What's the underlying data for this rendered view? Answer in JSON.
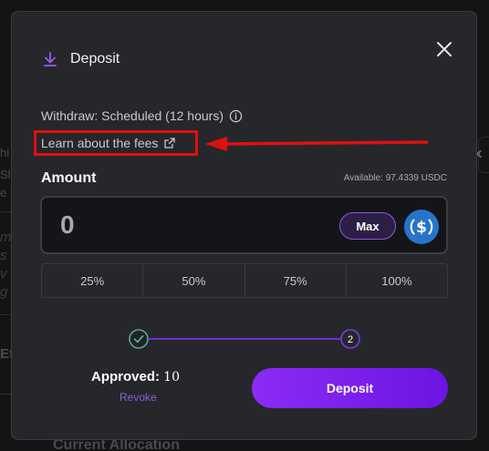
{
  "modal": {
    "title": "Deposit",
    "withdraw_text": "Withdraw: Scheduled (12 hours)",
    "learn_link": "Learn about the fees",
    "amount_label": "Amount",
    "available": "Available: 97.4339 USDC",
    "amount_value": "0",
    "max_label": "Max",
    "token_icon": "usdc-coin-icon",
    "percent_options": [
      "25%",
      "50%",
      "75%",
      "100%"
    ],
    "steps": {
      "step1": "check",
      "step2": "2"
    },
    "approved_label": "Approved:",
    "approved_value": "10",
    "revoke_label": "Revoke",
    "deposit_label": "Deposit"
  },
  "background": {
    "fragment_top": "hi",
    "fragment_s": "Sl",
    "fragment_e": "e",
    "fragment_m": "m",
    "fragment_s2": "s",
    "fragment_v": "v",
    "fragment_g": "g",
    "fragment_eth": "Eth",
    "right_fragment": "x",
    "footer_text": "Current Allocation"
  },
  "colors": {
    "accent_purple": "#8b2cf5",
    "annotation_red": "#e01010",
    "usdc_blue": "#2775ca"
  }
}
